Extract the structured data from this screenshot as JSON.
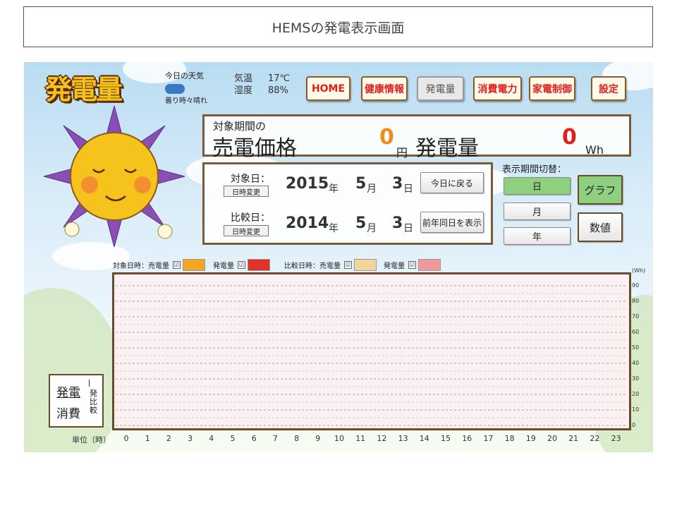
{
  "caption": "HEMSの発電表示画面",
  "logo": "発電量",
  "weather": {
    "today_label": "今日の天気",
    "condition": "曇り時々晴れ",
    "temp_label": "気温",
    "temp_value": "17℃",
    "humidity_label": "湿度",
    "humidity_value": "88%"
  },
  "nav": [
    "HOME",
    "健康情報",
    "発電量",
    "消費電力",
    "家電制御",
    "設定"
  ],
  "summary": {
    "period_label": "対象期間の",
    "sale_label": "売電価格",
    "sale_value": "0",
    "sale_unit": "円",
    "gen_label": "発電量",
    "gen_value": "0",
    "gen_unit": "Wh"
  },
  "dates": {
    "target_label": "対象日：",
    "compare_label": "比較日：",
    "change_button": "日時変更",
    "target": {
      "year": "2015",
      "month": "5",
      "day": "3"
    },
    "compare": {
      "year": "2014",
      "month": "5",
      "day": "3"
    },
    "year_unit": "年",
    "month_unit": "月",
    "day_unit": "日",
    "today_button": "今日に戻る",
    "prev_year_button": "前年同日を表示"
  },
  "period": {
    "title": "表示期間切替：",
    "day": "日",
    "month": "月",
    "year": "年",
    "graph": "グラフ",
    "numeric": "数値"
  },
  "legend": {
    "target_sale": "対象日時：売電量",
    "target_gen": "発電量",
    "compare_sale": "比較日時：売電量",
    "compare_gen": "発電量",
    "check": "☑",
    "colors": [
      "#f5a623",
      "#e0322a",
      "#f2d59b",
      "#ef9a9a"
    ]
  },
  "side": {
    "gen": "発電",
    "cons": "消費",
    "compare": "発比較"
  },
  "chart_data": {
    "type": "bar",
    "ylabel": "(Wh)",
    "ylim": [
      0,
      90
    ],
    "yticks": [
      "90",
      "80",
      "70",
      "60",
      "50",
      "40",
      "30",
      "20",
      "10",
      "0"
    ],
    "xlabel": "単位（時）",
    "categories": [
      "0",
      "1",
      "2",
      "3",
      "4",
      "5",
      "6",
      "7",
      "8",
      "9",
      "10",
      "11",
      "12",
      "13",
      "14",
      "15",
      "16",
      "17",
      "18",
      "19",
      "20",
      "21",
      "22",
      "23"
    ],
    "series": [],
    "grid": true
  }
}
